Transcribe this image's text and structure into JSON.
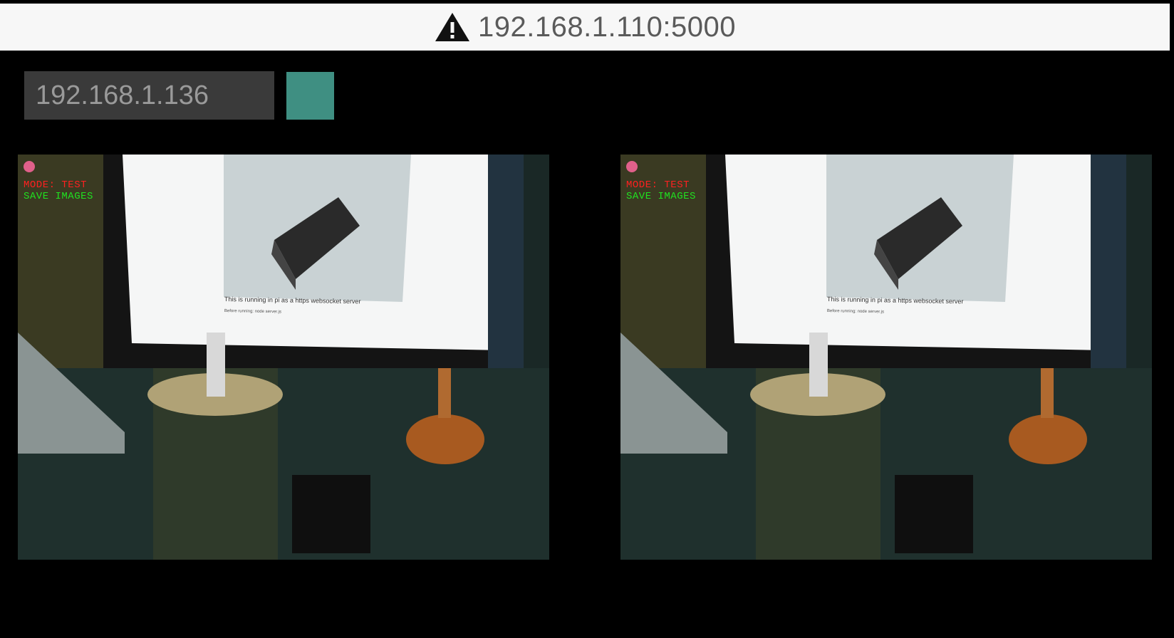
{
  "address_bar": {
    "url": "192.168.1.110:5000",
    "icon": "warning-triangle-icon"
  },
  "controls": {
    "ip_value": "192.168.1.136",
    "connect_button_color": "#3f8f82"
  },
  "views": {
    "left": {
      "mode_label": "MODE: TEST",
      "save_label": "SAVE IMAGES",
      "doc_caption": "This is running in pi as a https websocket server",
      "doc_before": "Before running: node server.js"
    },
    "right": {
      "mode_label": "MODE: TEST",
      "save_label": "SAVE IMAGES",
      "doc_caption": "This is running in pi as a https websocket server",
      "doc_before": "Before running: node server.js"
    }
  },
  "colors": {
    "hud_mode": "#ff2020",
    "hud_save": "#20e020",
    "record_dot": "#e0608a"
  }
}
